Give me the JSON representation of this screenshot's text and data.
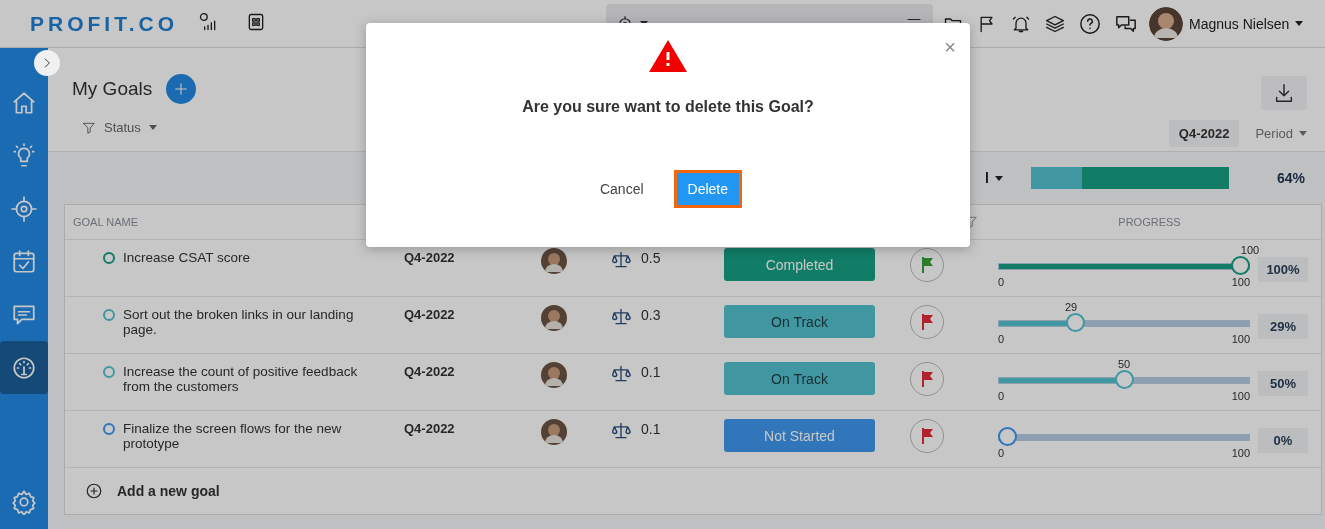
{
  "header": {
    "logo": "PROFIT.CO",
    "user": {
      "name": "Magnus Nielsen"
    }
  },
  "sidebar": {
    "items": [
      {
        "selected": false
      },
      {
        "selected": false
      },
      {
        "selected": false
      },
      {
        "selected": false
      },
      {
        "selected": false
      },
      {
        "selected": true
      }
    ]
  },
  "page": {
    "title": "My Goals",
    "filter": "Status",
    "period_chip": "Q4-2022",
    "period_dropdown": "Period"
  },
  "summary": {
    "dropdown_fragment": "l",
    "segments": [
      {
        "kind": "on_track",
        "level": 0.26
      },
      {
        "kind": "completed",
        "level": 0.74
      }
    ],
    "percent": "64%"
  },
  "table": {
    "columns": {
      "name": "GOAL NAME",
      "progress": "PROGRESS"
    },
    "rows": [
      {
        "name": "Increase CSAT score",
        "period": "Q4-2022",
        "weight": "0.5",
        "status": {
          "kind": "completed",
          "label": "Completed"
        },
        "flag": {
          "color": "#2a7d2a"
        },
        "level": 1,
        "value_label": "100",
        "min": "0",
        "max": "100",
        "percent": "100%"
      },
      {
        "name": "Sort out the broken links in our landing page.",
        "period": "Q4-2022",
        "weight": "0.3",
        "status": {
          "kind": "on_track",
          "label": "On Track"
        },
        "flag": {
          "color": "#b0222e"
        },
        "level": 0.29,
        "value_label": "29",
        "min": "0",
        "max": "100",
        "percent": "29%"
      },
      {
        "name": "Increase the count of positive feedback from the customers",
        "period": "Q4-2022",
        "weight": "0.1",
        "status": {
          "kind": "on_track",
          "label": "On Track"
        },
        "flag": {
          "color": "#b0222e"
        },
        "level": 0.5,
        "value_label": "50",
        "min": "0",
        "max": "100",
        "percent": "50%"
      },
      {
        "name": "Finalize the screen flows for the new prototype",
        "period": "Q4-2022",
        "weight": "0.1",
        "status": {
          "kind": "not_started",
          "label": "Not Started"
        },
        "flag": {
          "color": "#b0222e"
        },
        "level": 0,
        "min": "0",
        "max": "100",
        "percent": "0%"
      }
    ],
    "add_label": "Add a new goal"
  },
  "dialog": {
    "close": "×",
    "message": "Are you sure want to delete this Goal?",
    "buttons": [
      {
        "label": "Cancel",
        "kind": "secondary"
      },
      {
        "label": "Delete",
        "kind": "primary"
      }
    ]
  }
}
